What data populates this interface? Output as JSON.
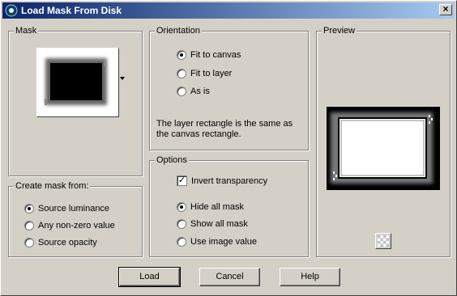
{
  "window": {
    "title": "Load Mask From Disk",
    "close_label": "×"
  },
  "mask_group": {
    "legend": "Mask"
  },
  "create_group": {
    "legend": "Create mask from:",
    "options": [
      {
        "label": "Source luminance",
        "checked": true
      },
      {
        "label": "Any non-zero value",
        "checked": false
      },
      {
        "label": "Source opacity",
        "checked": false
      }
    ]
  },
  "orientation_group": {
    "legend": "Orientation",
    "options": [
      {
        "label": "Fit to canvas",
        "checked": true
      },
      {
        "label": "Fit to layer",
        "checked": false
      },
      {
        "label": "As is",
        "checked": false
      }
    ],
    "description": "The layer rectangle is the same as the canvas rectangle."
  },
  "options_group": {
    "legend": "Options",
    "invert_label": "Invert transparency",
    "invert_checked": true,
    "check_mark": "✓",
    "options": [
      {
        "label": "Hide all mask",
        "checked": true
      },
      {
        "label": "Show all mask",
        "checked": false
      },
      {
        "label": "Use image value",
        "checked": false
      }
    ]
  },
  "preview_group": {
    "legend": "Preview"
  },
  "buttons": {
    "load": "Load",
    "cancel": "Cancel",
    "help": "Help"
  }
}
